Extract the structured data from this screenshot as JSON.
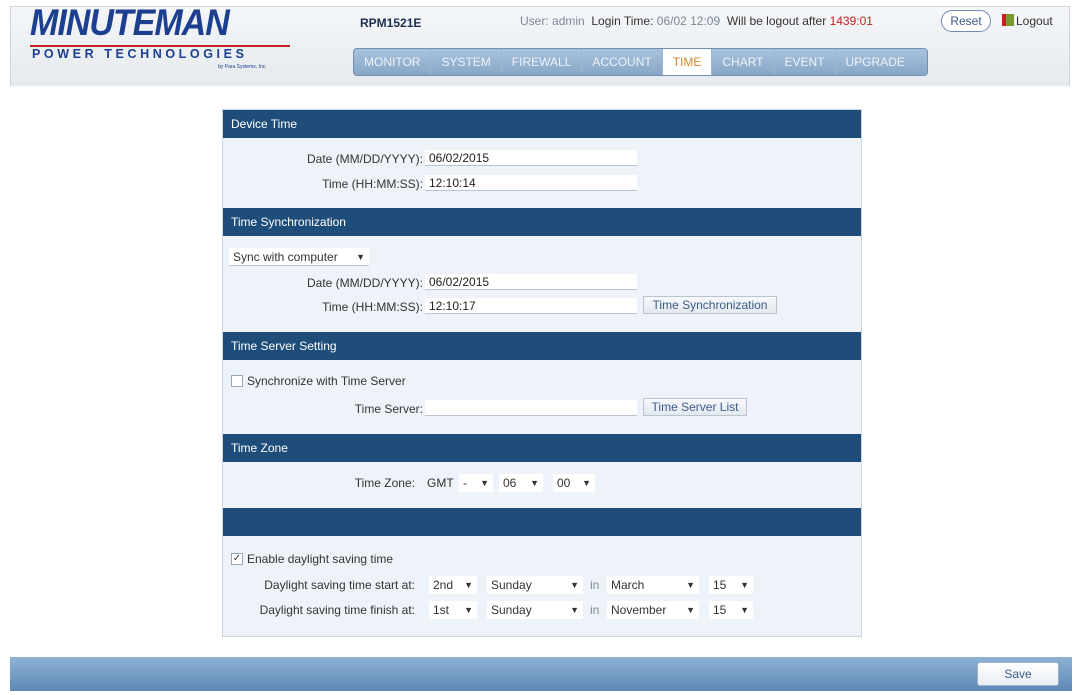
{
  "header": {
    "logo": {
      "main": "MINUTEMAN",
      "sub": "POWER TECHNOLOGIES",
      "tag": "by Para Systems, Inc."
    },
    "model": "RPM1521E",
    "user_label": "User:",
    "user": "admin",
    "login_label": "Login Time:",
    "login_time": "06/02 12:09",
    "logout_prefix": "Will be logout after",
    "logout_countdown": "1439:01",
    "reset_label": "Reset",
    "logout_label": "Logout",
    "colors": {
      "brand": "#1d3f8f",
      "tab_active": "#e08624",
      "countdown": "#c62020"
    }
  },
  "tabs": [
    {
      "label": "MONITOR"
    },
    {
      "label": "SYSTEM"
    },
    {
      "label": "FIREWALL"
    },
    {
      "label": "ACCOUNT"
    },
    {
      "label": "TIME",
      "active": true
    },
    {
      "label": "CHART"
    },
    {
      "label": "EVENT"
    },
    {
      "label": "UPGRADE"
    }
  ],
  "device_time": {
    "title": "Device Time",
    "date_label": "Date (MM/DD/YYYY):",
    "date_value": "06/02/2015",
    "time_label": "Time (HH:MM:SS):",
    "time_value": "12:10:14"
  },
  "time_sync": {
    "title": "Time Synchronization",
    "mode": "Sync with computer",
    "date_label": "Date (MM/DD/YYYY):",
    "date_value": "06/02/2015",
    "time_label": "Time (HH:MM:SS):",
    "time_value": "12:10:17",
    "button": "Time Synchronization"
  },
  "time_server": {
    "title": "Time Server Setting",
    "sync_label": "Synchronize with Time Server",
    "sync_checked": false,
    "server_label": "Time Server:",
    "server_value": "",
    "button": "Time Server List"
  },
  "time_zone": {
    "title": "Time Zone",
    "label": "Time Zone:",
    "prefix": "GMT",
    "sign": "-",
    "hours": "06",
    "minutes": "00"
  },
  "dst": {
    "title": "",
    "enable_label": "Enable daylight saving time",
    "enable_checked": true,
    "start_label": "Daylight saving time start at:",
    "start_week": "2nd",
    "start_day": "Sunday",
    "start_in": "in",
    "start_month": "March",
    "start_date": "15",
    "finish_label": "Daylight saving time finish at:",
    "finish_week": "1st",
    "finish_day": "Sunday",
    "finish_in": "in",
    "finish_month": "November",
    "finish_date": "15"
  },
  "footer": {
    "save_label": "Save"
  }
}
